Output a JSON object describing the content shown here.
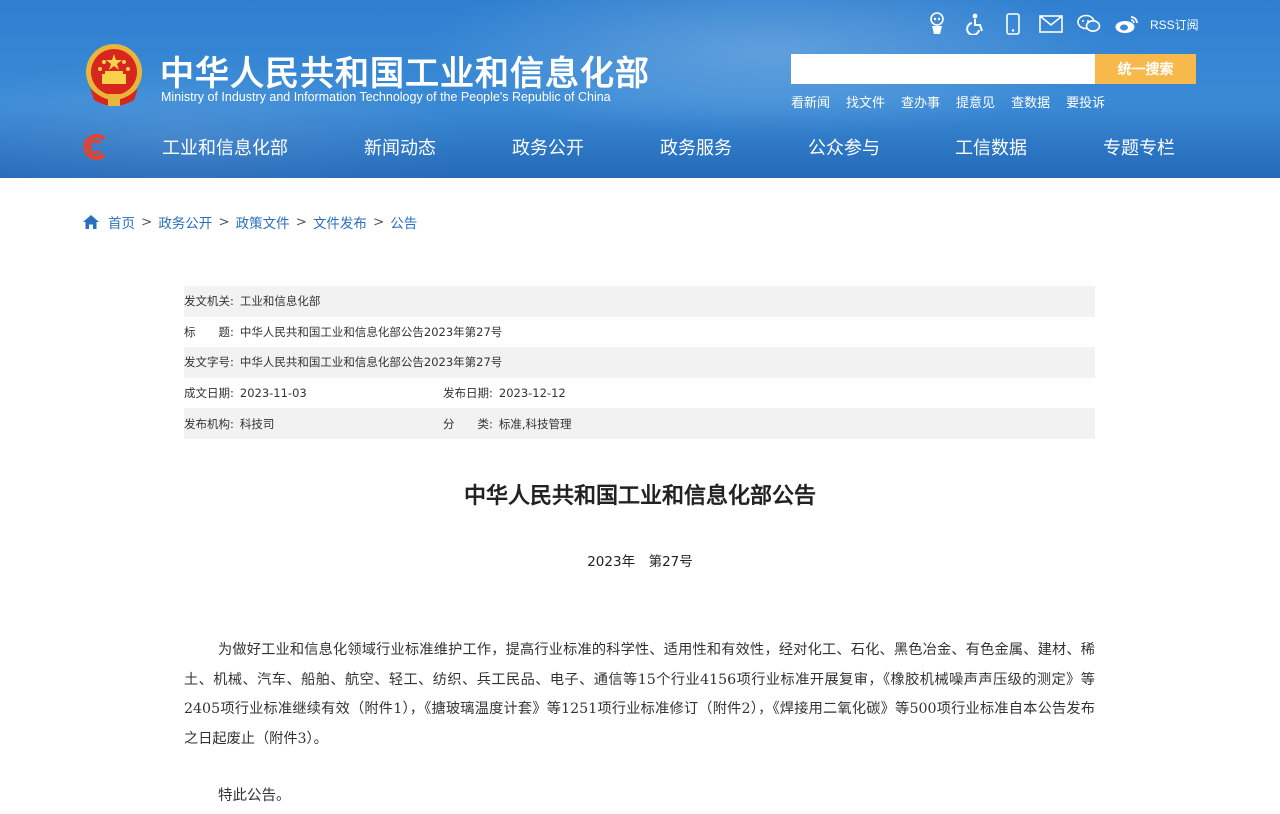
{
  "header": {
    "title_cn": "中华人民共和国工业和信息化部",
    "title_en": "Ministry of Industry and Information Technology of the People's Republic of China",
    "top_icons": [
      "robot-icon",
      "accessibility-icon",
      "mobile-icon",
      "mail-icon",
      "wechat-icon",
      "weibo-icon"
    ],
    "rss_label": "RSS订阅",
    "search": {
      "placeholder": "",
      "button_label": "统一搜索"
    },
    "quick_links": [
      "看新闻",
      "找文件",
      "查办事",
      "提意见",
      "查数据",
      "要投诉"
    ],
    "colors": {
      "bg": "#3a8ad6",
      "search_button": "#f6b94a",
      "logo_red": "#e8412c"
    }
  },
  "nav": {
    "items": [
      "工业和信息化部",
      "新闻动态",
      "政务公开",
      "政务服务",
      "公众参与",
      "工信数据",
      "专题专栏"
    ]
  },
  "breadcrumb": {
    "items": [
      "首页",
      "政务公开",
      "政策文件",
      "文件发布",
      "公告"
    ],
    "separator": ">"
  },
  "meta": {
    "issuer_label": "发文机关:",
    "issuer": "工业和信息化部",
    "title_label": "标　　题:",
    "title": "中华人民共和国工业和信息化部公告2023年第27号",
    "doc_no_label": "发文字号:",
    "doc_no": "中华人民共和国工业和信息化部公告2023年第27号",
    "written_date_label": "成文日期:",
    "written_date": "2023-11-03",
    "publish_date_label": "发布日期:",
    "publish_date": "2023-12-12",
    "publisher_label": "发布机构:",
    "publisher": "科技司",
    "category_label": "分　　类:",
    "category": "标准,科技管理"
  },
  "document": {
    "title": "中华人民共和国工业和信息化部公告",
    "number": "2023年　第27号",
    "body": "为做好工业和信息化领域行业标准维护工作，提高行业标准的科学性、适用性和有效性，经对化工、石化、黑色冶金、有色金属、建材、稀土、机械、汽车、船舶、航空、轻工、纺织、兵工民品、电子、通信等15个行业4156项行业标准开展复审，《橡胶机械噪声声压级的测定》等2405项行业标准继续有效（附件1），《搪玻璃温度计套》等1251项行业标准修订（附件2），《焊接用二氧化碳》等500项行业标准自本公告发布之日起废止（附件3）。",
    "closing": "特此公告。"
  }
}
